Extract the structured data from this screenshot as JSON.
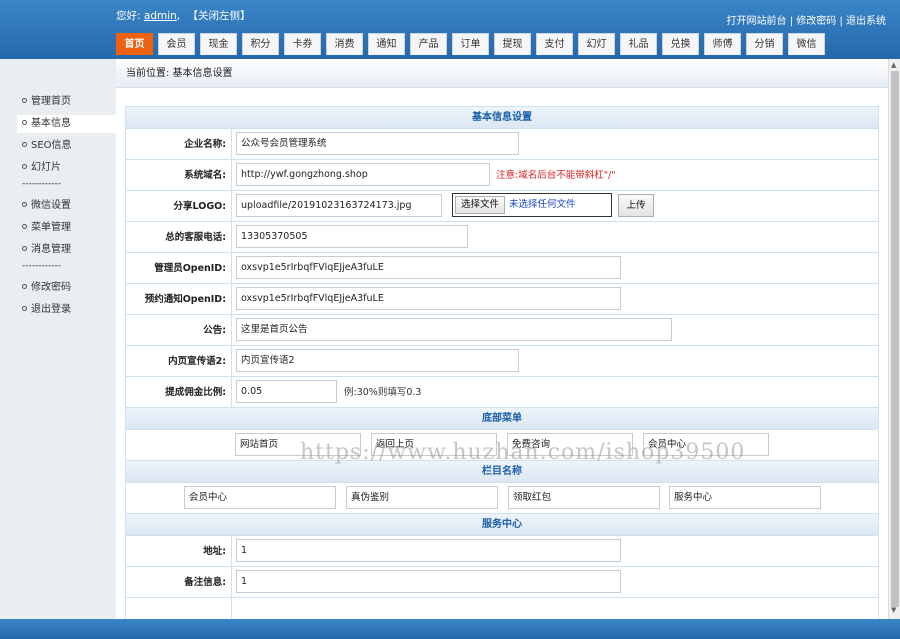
{
  "header": {
    "greeting_prefix": "您好:",
    "username": "admin",
    "greeting_suffix": ",",
    "close_left": "【关闭左侧】",
    "links": [
      "打开网站前台",
      "修改密码",
      "退出系统"
    ],
    "sep": "|"
  },
  "nav": {
    "tabs": [
      "首页",
      "会员",
      "现金",
      "积分",
      "卡券",
      "消费",
      "通知",
      "产品",
      "订单",
      "提现",
      "支付",
      "幻灯",
      "礼品",
      "兑换",
      "师傅",
      "分销",
      "微信"
    ],
    "active_index": 0
  },
  "sidebar": {
    "items": [
      "管理首页",
      "基本信息",
      "SEO信息",
      "幻灯片",
      "微信设置",
      "菜单管理",
      "消息管理",
      "修改密码",
      "退出登录"
    ],
    "separator": "------------",
    "active_index": 1
  },
  "breadcrumb": "当前位置: 基本信息设置",
  "form": {
    "section_basic": "基本信息设置",
    "company_label": "企业名称:",
    "company_value": "公众号会员管理系统",
    "domain_label": "系统域名:",
    "domain_value": "http://ywf.gongzhong.shop",
    "domain_note": "注意:域名后台不能带斜杠\"/\"",
    "logo_label": "分享LOGO:",
    "logo_value": "uploadfile/20191023163724173.jpg",
    "choose_file": "选择文件",
    "no_file": "未选择任何文件",
    "upload": "上传",
    "phone_label": "总的客服电话:",
    "phone_value": "13305370505",
    "admin_openid_label": "管理员OpenID:",
    "admin_openid_value": "oxsvp1e5rIrbqfFVlqEJjeA3fuLE",
    "notify_openid_label": "预约通知OpenID:",
    "notify_openid_value": "oxsvp1e5rIrbqfFVlqEJjeA3fuLE",
    "notice_label": "公告:",
    "notice_value": "这里是首页公告",
    "slogan_label": "内页宣传语2:",
    "slogan_value": "内页宣传语2",
    "commission_label": "提成佣金比例:",
    "commission_value": "0.05",
    "commission_note": "例:30%则填写0.3",
    "section_bottom_menu": "底部菜单",
    "bottom_menu": [
      "网站首页",
      "返回上页",
      "免费咨询",
      "会员中心"
    ],
    "section_column": "栏目名称",
    "columns": [
      "会员中心",
      "真伪鉴别",
      "领取红包",
      "服务中心"
    ],
    "section_service": "服务中心",
    "address_label": "地址:",
    "address_value": "1",
    "remark_label": "备注信息:",
    "remark_value": "1"
  },
  "watermark": "https://www.huzhan.com/ishop39500",
  "colors": {
    "header_blue": "#2f78bd",
    "active_tab": "#f0620f",
    "section_text": "#1a5fa8",
    "note_red": "#e02020"
  }
}
